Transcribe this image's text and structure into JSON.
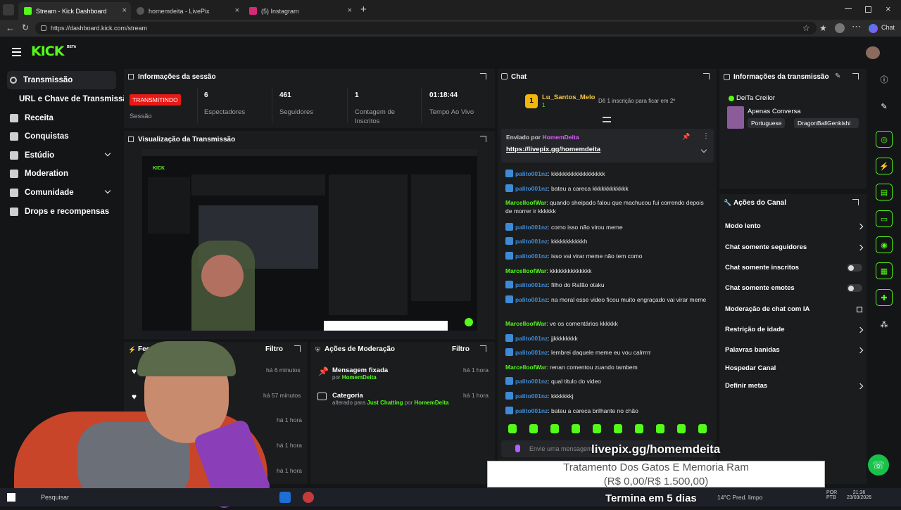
{
  "browser": {
    "tabs": [
      {
        "label": "Stream - Kick Dashboard",
        "active": true
      },
      {
        "label": "homemdeita - LivePix",
        "active": false
      },
      {
        "label": "(5) Instagram",
        "active": false
      }
    ],
    "url": "https://dashboard.kick.com/stream",
    "chat_button": "Chat"
  },
  "header": {
    "logo": "KICK",
    "logo_badge": "BETA"
  },
  "sidebar": {
    "items": [
      {
        "label": "Transmissão"
      },
      {
        "label": "URL e Chave de Transmissão"
      },
      {
        "label": "Receita"
      },
      {
        "label": "Conquistas"
      },
      {
        "label": "Estúdio"
      },
      {
        "label": "Moderation"
      },
      {
        "label": "Comunidade"
      },
      {
        "label": "Drops e recompensas"
      }
    ]
  },
  "session": {
    "title": "Informações da sessão",
    "status": "TRANSMITINDO",
    "status_label": "Sessão",
    "stats": [
      {
        "value": "6",
        "label": "Espectadores"
      },
      {
        "value": "461",
        "label": "Seguidores"
      },
      {
        "value": "1",
        "label": "Contagem de Inscritos"
      },
      {
        "value": "01:18:44",
        "label": "Tempo Ao Vivo"
      }
    ]
  },
  "preview": {
    "title": "Visualização da Transmissão"
  },
  "feed": {
    "title": "Feed de Atividade",
    "filter": "Filtro",
    "times": [
      "há 6 minutos",
      "há 57 minutos",
      "há 1 hora",
      "há 1 hora",
      "há 1 hora"
    ]
  },
  "mod_actions": {
    "title": "Ações de Moderação",
    "filter": "Filtro",
    "items": [
      {
        "title": "Mensagem fixada",
        "by": "por",
        "user": "HomemDeita",
        "time": "há 1 hora"
      },
      {
        "title": "Categoria",
        "by": "alterado para",
        "target": "Just Chatting",
        "by2": "por",
        "user": "HomemDeita",
        "time": "há 1 hora"
      }
    ]
  },
  "chat": {
    "title": "Chat",
    "top_user": "Lu_Santos_Melo",
    "top_count": "1",
    "sub_goal": "Dê 1 inscrição para ficar em 2º",
    "pinned_by_label": "Enviado por",
    "pinned_by": "HomemDeita",
    "pinned_link": "https://livepix.gg/homemdeita",
    "messages": [
      {
        "user": "palito001nz",
        "text": ": kkkkkkkkkkkkkkkkkk",
        "color": "#3d8bd6",
        "badge": true
      },
      {
        "user": "palito001nz",
        "text": ": bateu a careca kkkkkkkkkkkk",
        "color": "#3d8bd6",
        "badge": true
      },
      {
        "user": "MarcelloofWar",
        "text": ": quando sheipado falou que machucou fui correndo depois de morrer ir kkkkkk",
        "color": "#53fc18",
        "badge": false
      },
      {
        "user": "palito001nz",
        "text": ": como isso não virou meme",
        "color": "#3d8bd6",
        "badge": true
      },
      {
        "user": "palito001nz",
        "text": ": kkkkkkkkkkkh",
        "color": "#3d8bd6",
        "badge": true
      },
      {
        "user": "palito001nz",
        "text": ": isso vai virar meme não tem como",
        "color": "#3d8bd6",
        "badge": true
      },
      {
        "user": "MarcelloofWar",
        "text": ": kkkkkkkkkkkkkk",
        "color": "#53fc18",
        "badge": false
      },
      {
        "user": "palito001nz",
        "text": ": filho do Rafão otaku",
        "color": "#3d8bd6",
        "badge": true
      },
      {
        "user": "palito001nz",
        "text": ": na moral esse video ficou muito engraçado vai virar meme",
        "color": "#3d8bd6",
        "badge": true
      },
      {
        "user": "MarcelloofWar",
        "text": ": ve os comentários kkkkkk",
        "color": "#53fc18",
        "badge": false
      },
      {
        "user": "palito001nz",
        "text": ": jjkkkkkkkk",
        "color": "#3d8bd6",
        "badge": true
      },
      {
        "user": "palito001nz",
        "text": ": lembrei daquele meme eu vou calrrrrr",
        "color": "#3d8bd6",
        "badge": true
      },
      {
        "user": "MarcelloofWar",
        "text": ": renan comentou zuando tambem",
        "color": "#53fc18",
        "badge": false
      },
      {
        "user": "palito001nz",
        "text": ": qual titulo do video",
        "color": "#3d8bd6",
        "badge": true
      },
      {
        "user": "palito001nz",
        "text": ": kkkkkkkj",
        "color": "#3d8bd6",
        "badge": true
      },
      {
        "user": "palito001nz",
        "text": ": bateu a careca brilhante no chão",
        "color": "#3d8bd6",
        "badge": true
      }
    ],
    "input_placeholder": "Envie uma mensagem"
  },
  "stream_info": {
    "title": "Informações da transmissão",
    "streamer": "DeiTa Creilor",
    "category": "Apenas Conversa",
    "tags": [
      "Portuguese",
      "DragonBallGenkishi"
    ]
  },
  "channel_actions": {
    "title": "Ações do Canal",
    "items": [
      {
        "label": "Modo lento",
        "control": "chevron"
      },
      {
        "label": "Chat somente seguidores",
        "control": "chevron"
      },
      {
        "label": "Chat somente inscritos",
        "control": "toggle"
      },
      {
        "label": "Chat somente emotes",
        "control": "toggle"
      },
      {
        "label": "Moderação de chat com IA",
        "control": "external"
      },
      {
        "label": "Restrição de idade",
        "control": "chevron"
      },
      {
        "label": "Palavras banidas",
        "control": "chevron"
      },
      {
        "label": "Hospedar Canal",
        "control": "none"
      },
      {
        "label": "Definir metas",
        "control": "chevron"
      }
    ]
  },
  "overlay": {
    "livepix_url": "livepix.gg/homemdeita",
    "goal_title": "Tratamento Dos Gatos E Memoria Ram",
    "goal_amount": "(R$ 0,00/R$ 1.500,00)",
    "goal_ends": "Termina em 5 dias"
  },
  "taskbar": {
    "search": "Pesquisar",
    "weather": "14°C Pred. limpo",
    "lang": "POR",
    "lang2": "PTB",
    "time": "21:36",
    "date": "23/03/2026"
  },
  "colors": {
    "accent": "#53fc18",
    "live": "#e91916",
    "bg": "#141517",
    "panel": "#1b1c1e"
  }
}
